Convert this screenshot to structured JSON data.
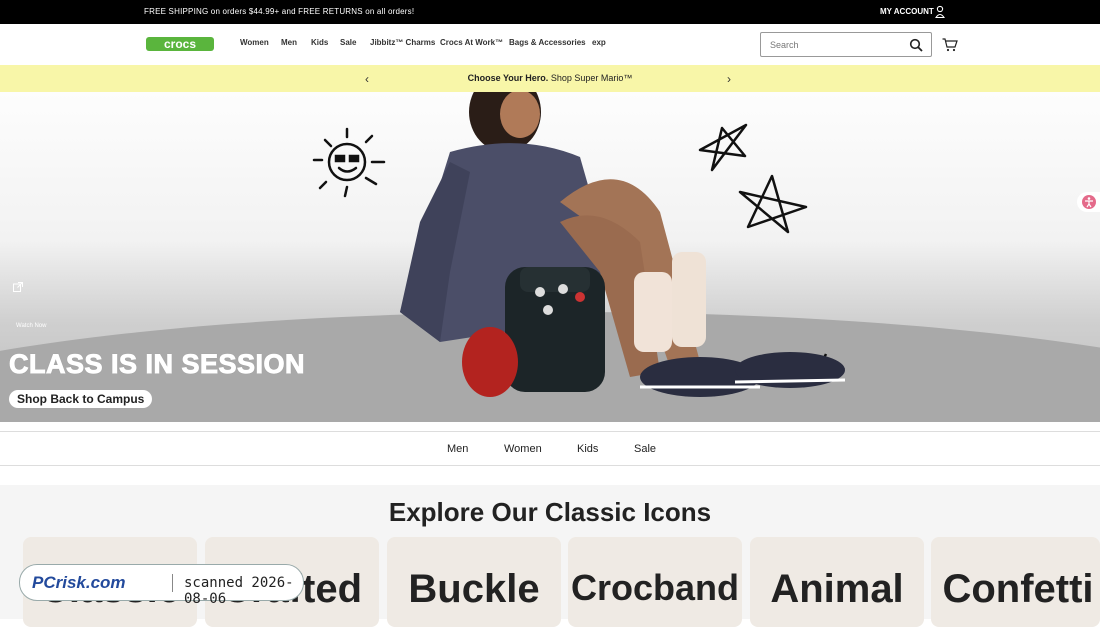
{
  "topbar": {
    "promo_text": "FREE SHIPPING on orders $44.99+ and FREE RETURNS on all orders!",
    "account_label": "MY ACCOUNT"
  },
  "header": {
    "logo_text": "crocs",
    "nav": [
      "Women",
      "Men",
      "Kids",
      "Sale",
      "Jibbitz™ Charms",
      "Crocs At Work™",
      "Bags & Accessories",
      "exp"
    ],
    "search_placeholder": "Search"
  },
  "banner": {
    "bold_text": "Choose Your Hero.",
    "link_text": "Shop Super Mario™"
  },
  "hero": {
    "headline": "CLASS IS IN SESSION",
    "cta_label": "Shop Back to Campus",
    "watch_label": "Watch Now"
  },
  "category_bar": [
    "Men",
    "Women",
    "Kids",
    "Sale"
  ],
  "explore": {
    "title": "Explore Our Classic Icons",
    "cards": [
      "Classic",
      "Crafted",
      "Buckle",
      "Crocband",
      "Animal",
      "Confetti"
    ]
  },
  "watermark": {
    "brand": "PCrisk.com",
    "scan_text": "scanned 2026-08-06"
  },
  "colors": {
    "topbar_bg": "#000000",
    "banner_bg": "#f8f6a8",
    "brand_green": "#5ab53d"
  }
}
